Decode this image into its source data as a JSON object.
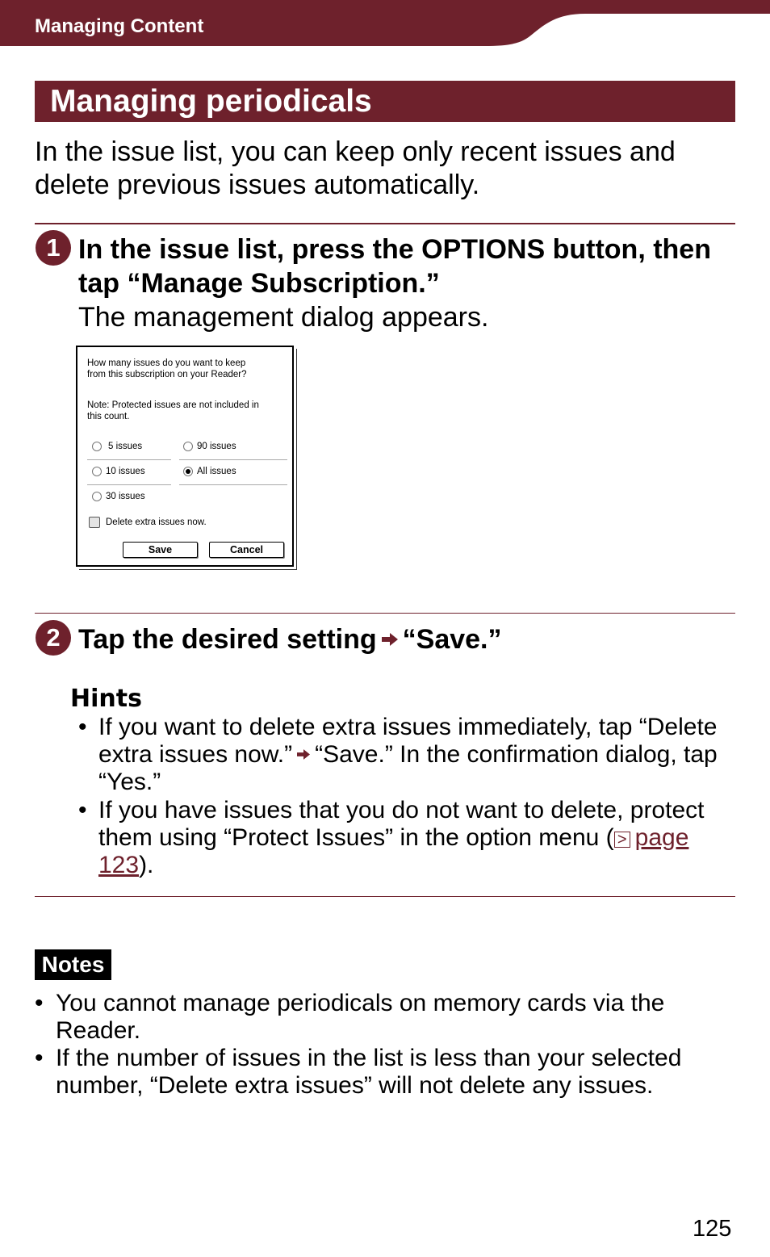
{
  "header": {
    "chapter": "Managing Content",
    "accent_color": "#6e212c"
  },
  "section": {
    "title": "Managing periodicals",
    "intro_line1": "In the issue list, you can keep only recent issues and",
    "intro_line2": "delete previous issues automatically."
  },
  "steps": [
    {
      "number": "1",
      "instruction_line1": "In the issue list, press the OPTIONS button, then",
      "instruction_line2": "tap “Manage Subscription.”",
      "result": "The management dialog appears."
    },
    {
      "number": "2",
      "instruction_before": "Tap the desired setting",
      "arrow_icon": "right-arrow",
      "instruction_after": "“Save.”"
    }
  ],
  "dialog": {
    "question_line1": "How many issues do you want to keep",
    "question_line2": "from this subscription on your Reader?",
    "note_line1": "Note: Protected issues are not included in",
    "note_line2": "this count.",
    "options": [
      {
        "label": "5 issues",
        "selected": false
      },
      {
        "label": "90 issues",
        "selected": false
      },
      {
        "label": "10 issues",
        "selected": false
      },
      {
        "label": "All issues",
        "selected": true
      },
      {
        "label": "30 issues",
        "selected": false
      }
    ],
    "checkbox_label": "Delete extra issues now.",
    "checkbox_checked": false,
    "save_label": "Save",
    "cancel_label": "Cancel"
  },
  "hints": {
    "title": "Hints",
    "items": [
      {
        "line1": "If you want to delete extra issues immediately, tap “Delete",
        "line2_before": "extra issues now.”",
        "line2_after": "“Save.” In the confirmation dialog, tap",
        "line3": "“Yes.”"
      },
      {
        "line1": "If you have issues that you do not want to delete, protect",
        "line2_before": "them using “Protect Issues” in the option menu (",
        "ref_icon": ">",
        "link_part1": "page ",
        "link_part2": "123",
        "after_link": ")."
      }
    ]
  },
  "notes": {
    "label": "Notes",
    "items": [
      {
        "line1": "You cannot manage periodicals on memory cards via the",
        "line2": "Reader."
      },
      {
        "line1": "If the number of issues in the list is less than your selected",
        "line2": "number, “Delete extra issues” will not delete any issues."
      }
    ]
  },
  "footer": {
    "page_number": "125"
  }
}
